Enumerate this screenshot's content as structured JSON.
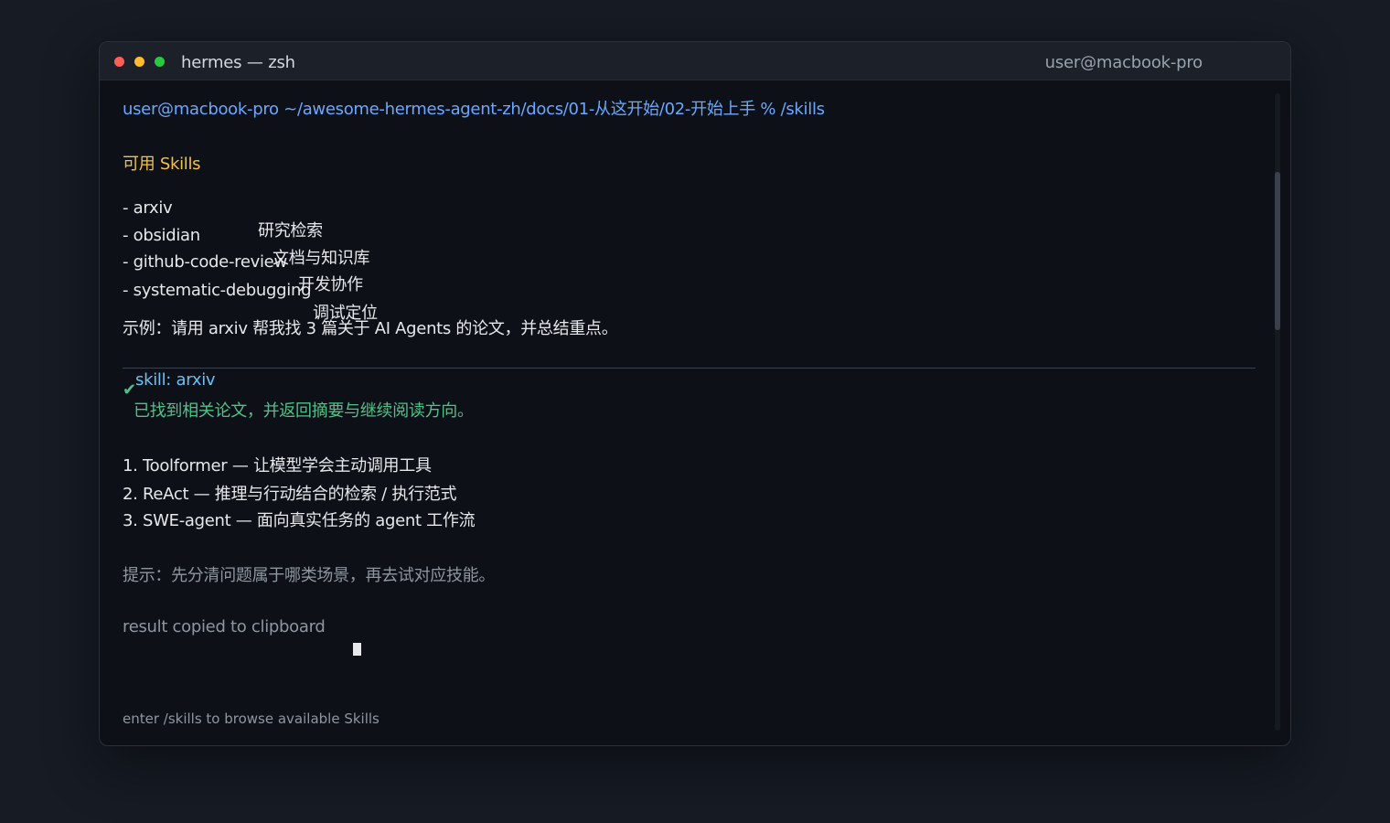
{
  "window": {
    "title": "hermes — zsh",
    "host": "user@macbook-pro"
  },
  "terminal": {
    "prompt": "user@macbook-pro ~/awesome-hermes-agent-zh/docs/01-从这开始/02-开始上手 % /skills",
    "skills_heading": "可用 Skills",
    "skills": [
      {
        "name": "- arxiv",
        "desc": "研究检索"
      },
      {
        "name": "- obsidian",
        "desc": "文档与知识库"
      },
      {
        "name": "- github-code-review",
        "desc": "开发协作"
      },
      {
        "name": "- systematic-debugging",
        "desc": "调试定位"
      }
    ],
    "example": "示例：请用 arxiv 帮我找 3 篇关于 AI Agents 的论文，并总结重点。",
    "skill_call": "skill: arxiv",
    "skill_call_prefix": "",
    "skill_result": "已找到相关论文，并返回摘要与继续阅读方向。",
    "results": [
      "1. Toolformer — 让模型学会主动调用工具",
      "2. ReAct — 推理与行动结合的检索 / 执行范式",
      "3. SWE-agent — 面向真实任务的 agent 工作流"
    ],
    "tip": "提示：先分清问题属于哪类场景，再去试对应技能。",
    "copied": "result copied to clipboard",
    "input_hint": "enter /skills to browse available Skills"
  },
  "colors": {
    "prompt": "#6aa8ff",
    "heading": "#f0c14b",
    "success": "#4fc28a",
    "skill": "#6bc0f5"
  }
}
